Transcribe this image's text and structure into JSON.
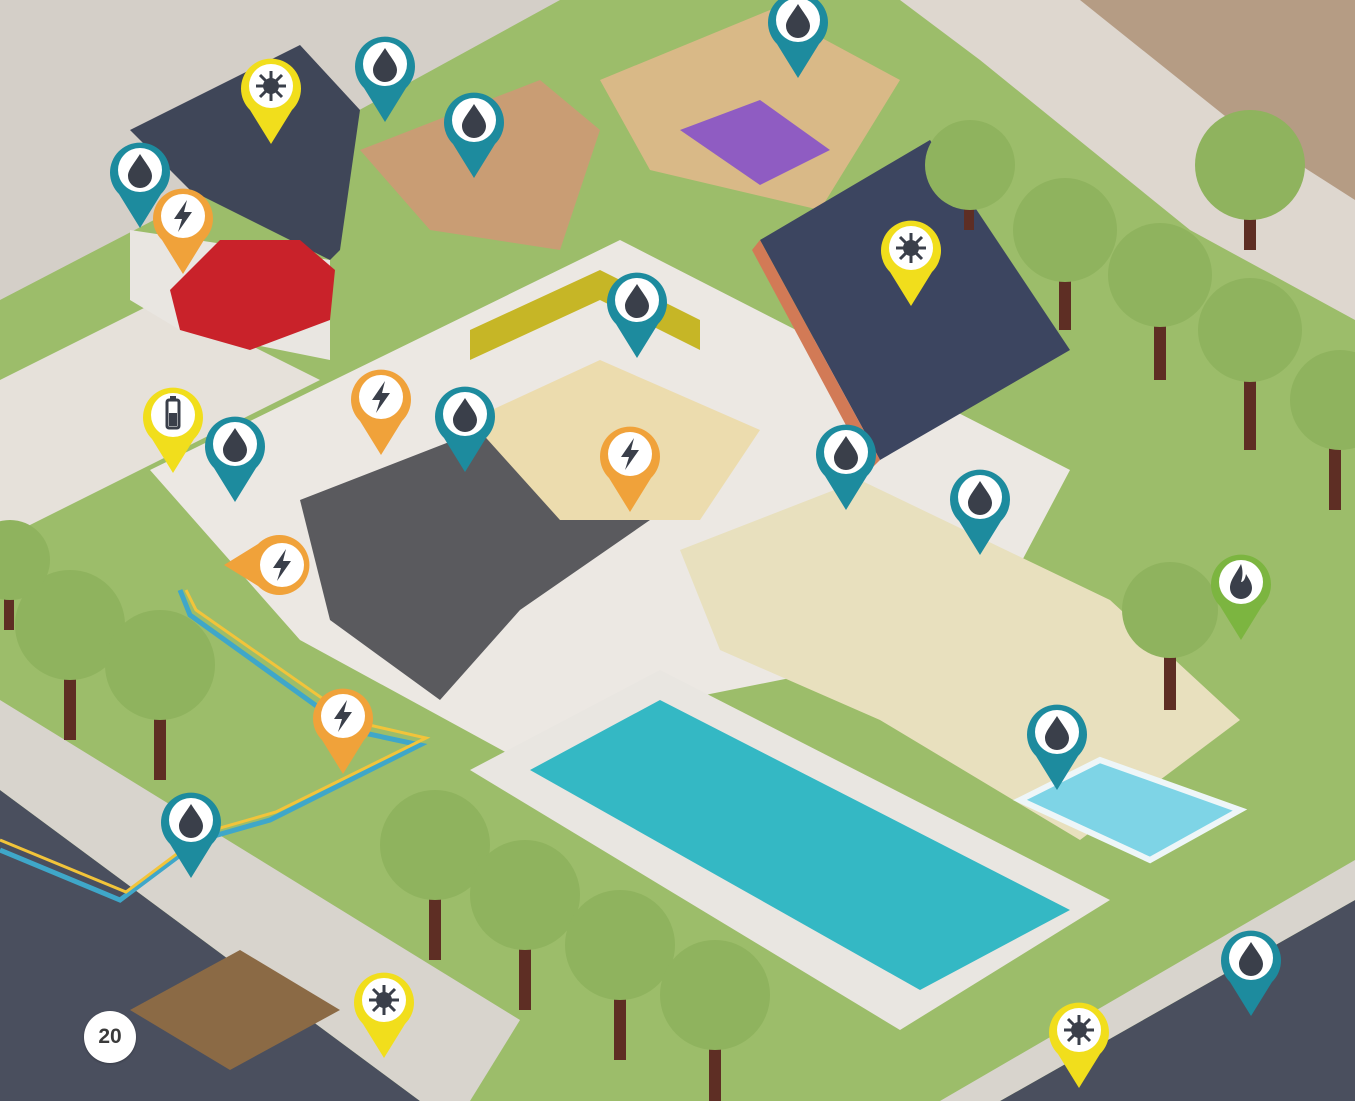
{
  "page": {
    "number": "20"
  },
  "colors": {
    "water": "#1d8b9e",
    "electricity": "#f0a23a",
    "solar": "#f1de1c",
    "gas": "#7cb540",
    "battery": "#f1de1c",
    "lawn": "#9cbd6a",
    "pool": "#34b8c4",
    "street": "#4a4f5e"
  },
  "markers": [
    {
      "kind": "water",
      "icon": "water-drop-icon"
    },
    {
      "kind": "water",
      "icon": "water-drop-icon"
    },
    {
      "kind": "water",
      "icon": "water-drop-icon"
    },
    {
      "kind": "water",
      "icon": "water-drop-icon"
    },
    {
      "kind": "water",
      "icon": "water-drop-icon"
    },
    {
      "kind": "water",
      "icon": "water-drop-icon"
    },
    {
      "kind": "water",
      "icon": "water-drop-icon"
    },
    {
      "kind": "water",
      "icon": "water-drop-icon"
    },
    {
      "kind": "water",
      "icon": "water-drop-icon"
    },
    {
      "kind": "water",
      "icon": "water-drop-icon"
    },
    {
      "kind": "water",
      "icon": "water-drop-icon"
    },
    {
      "kind": "water",
      "icon": "water-drop-icon"
    },
    {
      "kind": "electricity",
      "icon": "lightning-bolt-icon"
    },
    {
      "kind": "electricity",
      "icon": "lightning-bolt-icon"
    },
    {
      "kind": "electricity",
      "icon": "lightning-bolt-icon"
    },
    {
      "kind": "electricity",
      "icon": "lightning-bolt-icon"
    },
    {
      "kind": "electricity",
      "icon": "lightning-bolt-icon"
    },
    {
      "kind": "solar",
      "icon": "sun-icon"
    },
    {
      "kind": "solar",
      "icon": "sun-icon"
    },
    {
      "kind": "solar",
      "icon": "sun-icon"
    },
    {
      "kind": "solar",
      "icon": "sun-icon"
    },
    {
      "kind": "battery",
      "icon": "battery-icon"
    },
    {
      "kind": "gas",
      "icon": "gas-flame-icon"
    }
  ]
}
